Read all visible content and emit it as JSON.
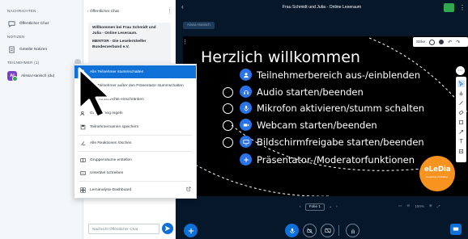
{
  "sidebar": {
    "messages_title": "NACHRICHTEN",
    "public_chat": "Öffentlicher Chat",
    "notes_title": "NOTIZEN",
    "shared_notes": "Geteilte Notizen",
    "participants_title": "TEILNEHMER (1)",
    "participant_name": "Alissa Hanisch (du)",
    "participant_initials": "Al"
  },
  "chat": {
    "header": "Öffentlicher Chat",
    "welcome_line1": "Willkommen bei Frau Schmidt und",
    "welcome_line2": "Julia - Online Leseraum.",
    "welcome_line3": "MENTOR - Die Leselernhelfer",
    "welcome_line4": "Bundesverband e.V.",
    "input_placeholder": "Nachricht Öffentlicher Chat"
  },
  "menu": {
    "items": [
      {
        "label": "Alle Teilnehmer stummschalten",
        "icon": "mic-mute-icon"
      },
      {
        "label": "Alle Teilnehmer außer den Präsentator stummschalten",
        "icon": "mic-mute-icon"
      },
      {
        "label": "Teilnehmerrechte einschränken",
        "icon": "lock-icon"
      },
      {
        "label": "Gastzugang regeln",
        "icon": "user-plus-icon"
      },
      {
        "label": "Teilnehmernamen speichern",
        "icon": "save-icon"
      },
      {
        "label": "Alle Reaktionen löschen",
        "icon": "clear-icon"
      },
      {
        "label": "Gruppenräume erstellen",
        "icon": "rooms-icon"
      },
      {
        "label": "Untertitel schreiben",
        "icon": "captions-icon"
      },
      {
        "label": "Lernanalyse-Dashboard",
        "icon": "dashboard-icon"
      }
    ]
  },
  "main": {
    "title": "Frau Schmidt und Julia - Online Leseraum",
    "presenter_name": "Alissa Hanisch",
    "slide_title": "Herzlich willkommen",
    "bullets": [
      "Teilnehmerbereich aus-/einblenden",
      "Audio starten/beenden",
      "Mikrofon aktivieren/stumm schalten",
      "Webcam starten/beenden",
      "Bildschirmfreigabe starten/beenden",
      "Präsentator-/Moderatorfunktionen"
    ],
    "logo_text": "eLeDia",
    "logo_sub": "eLearning im Dialog",
    "slide_select": "Folie 1",
    "zoom": "100%",
    "stroke_label": "Strke"
  },
  "colors": {
    "primary": "#0f70d7",
    "bg_dark": "#06172a",
    "bullet_blue": "#2a73e8",
    "logo_orange": "#f7931e"
  }
}
